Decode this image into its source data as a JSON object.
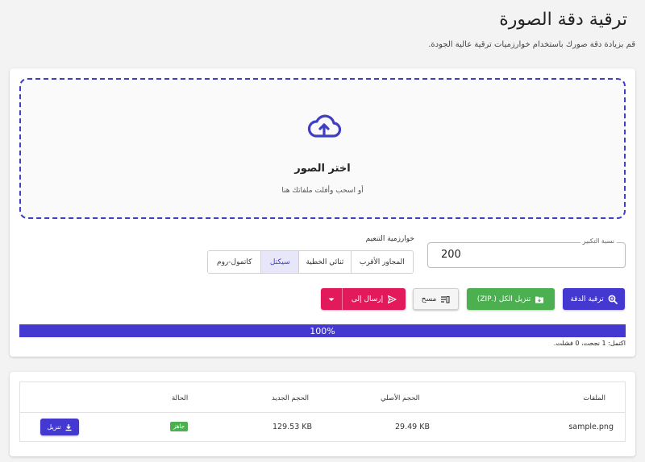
{
  "header": {
    "title": "ترقية دقة الصورة",
    "subtitle": "قم بزيادة دقة صورك باستخدام خوارزميات ترقية عالية الجودة."
  },
  "dropzone": {
    "title": "اختر الصور",
    "hint": "أو اسحب وأفلت ملفاتك هنا",
    "icon": "cloud-upload-icon"
  },
  "scale": {
    "label": "نسبة التكبير",
    "value": "200"
  },
  "algorithm": {
    "label": "خوارزمية التنعيم",
    "options": [
      "المجاور الأقرب",
      "ثنائي الخطية",
      "سيكتل",
      "كاتمول-روم"
    ],
    "selected": "سيكتل"
  },
  "actions": {
    "upscale_label": "ترقية الدقة",
    "download_all_label": "تنزيل الكل (.ZIP)",
    "clear_label": "مسح",
    "send_label": "إرسال إلى"
  },
  "progress": {
    "percent": 100,
    "label": "100%",
    "status": "اكتمل: 1 نجحت، 0 فشلت."
  },
  "table": {
    "headers": {
      "files": "الملفات",
      "original_size": "الحجم الأصلي",
      "new_size": "الحجم الجديد",
      "status": "الحالة"
    },
    "rows": [
      {
        "filename": "sample.png",
        "original_size": "29.49 KB",
        "new_size": "129.53 KB",
        "status": "جاهز",
        "download_label": "تنزيل"
      }
    ]
  },
  "colors": {
    "primary": "#4338d0",
    "success": "#4caf50",
    "send": "#e21a5b"
  }
}
